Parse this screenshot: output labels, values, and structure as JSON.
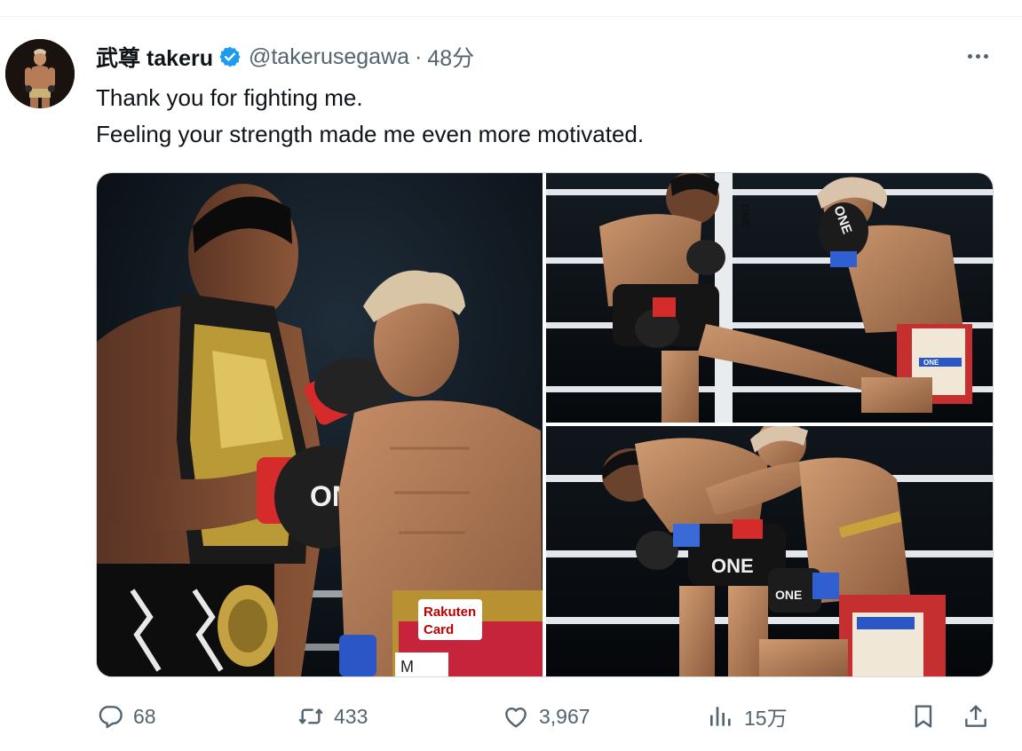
{
  "tweet": {
    "author": {
      "display_name": "武尊 takeru",
      "handle": "@takerusegawa",
      "verified": true,
      "avatar_icon": "avatar-photo"
    },
    "separator": "·",
    "time": "48分",
    "text_lines": [
      "Thank you for fighting me.",
      "Feeling your strength made me even more motivated."
    ],
    "media": {
      "photo_1_text": [
        "Rakuten",
        "Card",
        "M",
        "ONE"
      ],
      "photo_2_text": [
        "ONE",
        "ONE",
        "ONE"
      ],
      "photo_3_text": [
        "ONE",
        "ONE"
      ]
    },
    "metrics": {
      "replies": "68",
      "retweets": "433",
      "likes": "3,967",
      "views": "15万"
    }
  },
  "colors": {
    "text_primary": "#0f1419",
    "text_secondary": "#536471",
    "verified_blue": "#1d9bf0",
    "border": "#cfd9de"
  },
  "icons": {
    "reply": "speech-bubble-icon",
    "retweet": "retweet-arrows-icon",
    "like": "heart-icon",
    "views": "bar-chart-icon",
    "bookmark": "bookmark-icon",
    "share": "share-upload-icon",
    "more": "more-dots-icon",
    "verified": "verified-badge-icon"
  }
}
